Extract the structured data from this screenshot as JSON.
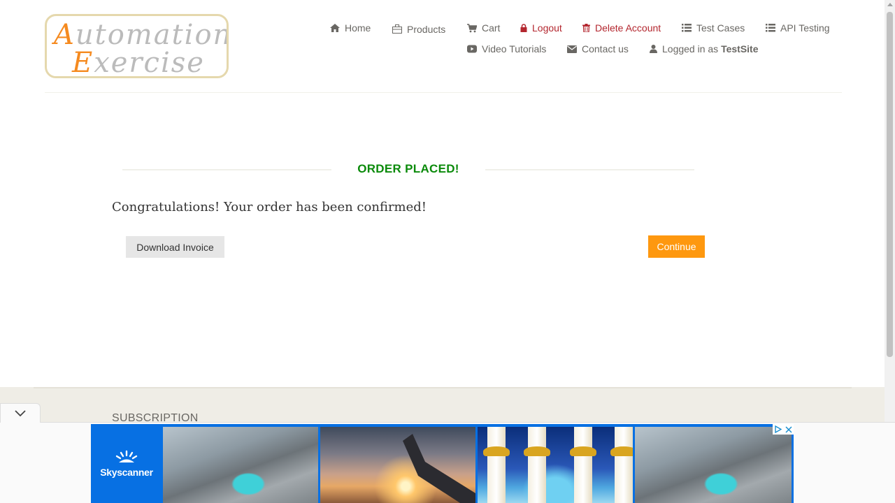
{
  "logo": {
    "line1_cap": "A",
    "line1_rest": "utomation",
    "line2_cap": "E",
    "line2_rest": "xercise"
  },
  "nav": {
    "home": "Home",
    "products": "Products",
    "cart": "Cart",
    "logout": "Logout",
    "delete_account": "Delete Account",
    "test_cases": "Test Cases",
    "api_testing": "API Testing",
    "video_tutorials": "Video Tutorials",
    "contact_us": "Contact us",
    "logged_in_prefix": "Logged in as",
    "logged_in_user": "TestSite"
  },
  "order": {
    "title": "ORDER PLACED!",
    "message": "Congratulations! Your order has been confirmed!",
    "download_invoice": "Download Invoice",
    "continue": "Continue"
  },
  "footer": {
    "subscription_title": "SUBSCRIPTION"
  },
  "ad": {
    "brand": "Skyscanner"
  },
  "colors": {
    "accent": "#fe980f",
    "success": "#0a8a0a",
    "danger": "#b3262e",
    "ad_blue": "#0770e3"
  }
}
